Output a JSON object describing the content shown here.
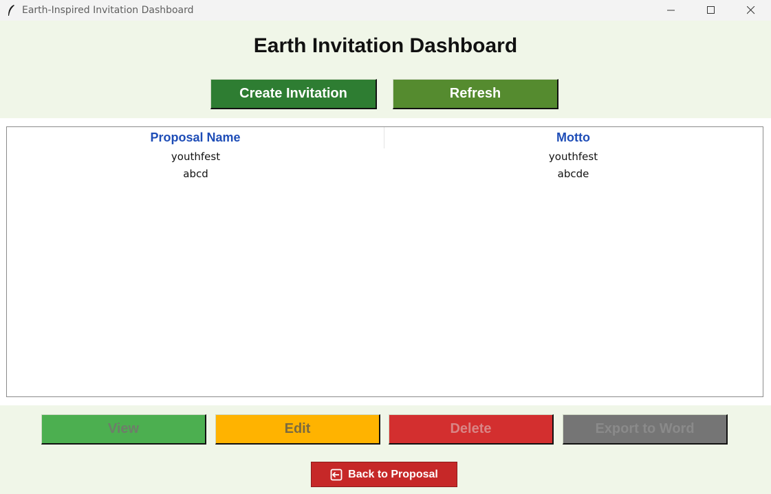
{
  "window": {
    "title": "Earth-Inspired Invitation Dashboard",
    "icon": "feather-icon",
    "controls": [
      "minimize-icon",
      "maximize-icon",
      "close-icon"
    ]
  },
  "header": {
    "title": "Earth Invitation Dashboard",
    "create_label": "Create Invitation",
    "refresh_label": "Refresh"
  },
  "table": {
    "columns": [
      "Proposal Name",
      "Motto"
    ],
    "rows": [
      [
        "youthfest",
        "youthfest"
      ],
      [
        "abcd",
        "abcde"
      ]
    ]
  },
  "actions": {
    "view_label": "View",
    "edit_label": "Edit",
    "delete_label": "Delete",
    "export_label": "Export to Word"
  },
  "footer": {
    "back_label": "Back to Proposal",
    "back_icon": "back-arrow-icon"
  },
  "colors": {
    "background": "#f0f6e8",
    "create": "#2e7d32",
    "refresh": "#558b2f",
    "view": "#4caf50",
    "edit": "#ffb300",
    "delete": "#d32f2f",
    "export": "#757575",
    "back": "#c62828",
    "header_text": "#1e4db7"
  }
}
